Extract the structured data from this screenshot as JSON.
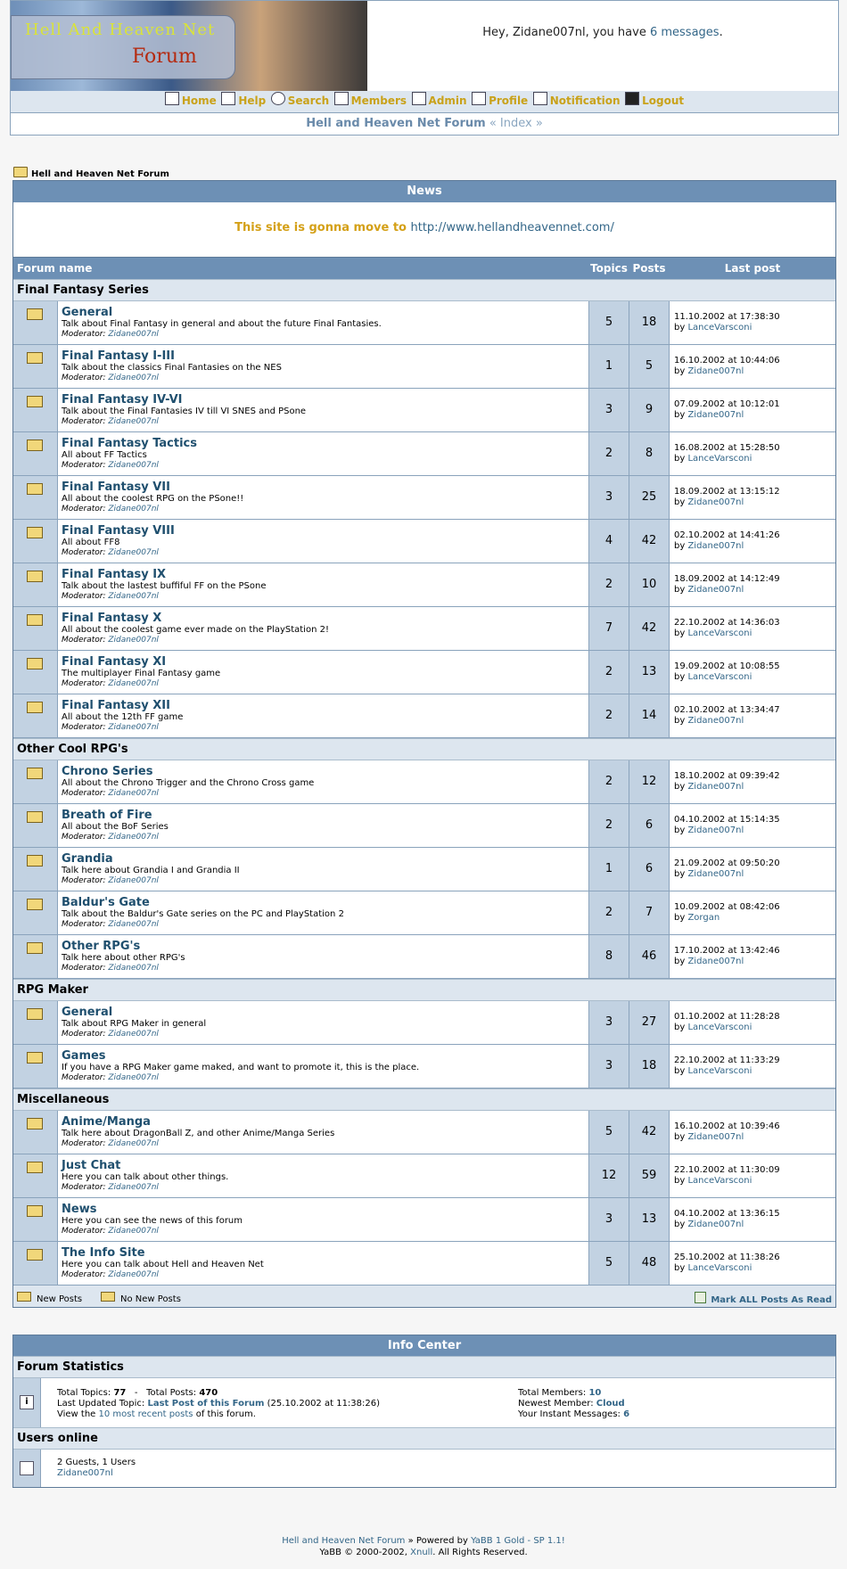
{
  "header": {
    "banner_title": "Hell And Heaven Net",
    "banner_sub": "Forum",
    "greeting_prefix": "Hey, Zidane007nl, you have ",
    "greeting_link": "6 messages",
    "greeting_suffix": "."
  },
  "nav": {
    "items": [
      {
        "label": "Home",
        "icon": "home-icon"
      },
      {
        "label": "Help",
        "icon": "help-icon"
      },
      {
        "label": "Search",
        "icon": "search-icon"
      },
      {
        "label": "Members",
        "icon": "members-icon"
      },
      {
        "label": "Admin",
        "icon": "admin-icon"
      },
      {
        "label": "Profile",
        "icon": "profile-icon"
      },
      {
        "label": "Notification",
        "icon": "notification-icon"
      },
      {
        "label": "Logout",
        "icon": "logout-icon"
      }
    ]
  },
  "crumb": {
    "forum": "Hell and Heaven Net Forum",
    "index": " « Index »"
  },
  "path": {
    "label": "Hell and Heaven Net Forum"
  },
  "news": {
    "title": "News",
    "text": "This site is gonna move to ",
    "link": "http://www.hellandheavennet.com/"
  },
  "columns": {
    "forum": "Forum name",
    "topics": "Topics",
    "posts": "Posts",
    "last": "Last post"
  },
  "categories": [
    {
      "name": "Final Fantasy Series",
      "forums": [
        {
          "name": "General",
          "desc": "Talk about Final Fantasy in general and about the future Final Fantasies.",
          "topics": "5",
          "posts": "18",
          "date": "11.10.2002 at 17:38:30",
          "by": "LanceVarsconi"
        },
        {
          "name": "Final Fantasy I-III",
          "desc": "Talk about the classics Final Fantasies on the NES",
          "topics": "1",
          "posts": "5",
          "date": "16.10.2002 at 10:44:06",
          "by": "Zidane007nl"
        },
        {
          "name": "Final Fantasy IV-VI",
          "desc": "Talk about the Final Fantasies IV till VI SNES and PSone",
          "topics": "3",
          "posts": "9",
          "date": "07.09.2002 at 10:12:01",
          "by": "Zidane007nl"
        },
        {
          "name": "Final Fantasy Tactics",
          "desc": "All about FF Tactics",
          "topics": "2",
          "posts": "8",
          "date": "16.08.2002 at 15:28:50",
          "by": "LanceVarsconi"
        },
        {
          "name": "Final Fantasy VII",
          "desc": "All about the coolest RPG on the PSone!!",
          "topics": "3",
          "posts": "25",
          "date": "18.09.2002 at 13:15:12",
          "by": "Zidane007nl"
        },
        {
          "name": "Final Fantasy VIII",
          "desc": "All about FF8",
          "topics": "4",
          "posts": "42",
          "date": "02.10.2002 at 14:41:26",
          "by": "Zidane007nl"
        },
        {
          "name": "Final Fantasy IX",
          "desc": "Talk about the lastest buffiful FF on the PSone",
          "topics": "2",
          "posts": "10",
          "date": "18.09.2002 at 14:12:49",
          "by": "Zidane007nl"
        },
        {
          "name": "Final Fantasy X",
          "desc": "All about the coolest game ever made on the PlayStation 2!",
          "topics": "7",
          "posts": "42",
          "date": "22.10.2002 at 14:36:03",
          "by": "LanceVarsconi"
        },
        {
          "name": "Final Fantasy XI",
          "desc": "The multiplayer Final Fantasy game",
          "topics": "2",
          "posts": "13",
          "date": "19.09.2002 at 10:08:55",
          "by": "LanceVarsconi"
        },
        {
          "name": "Final Fantasy XII",
          "desc": "All about the 12th FF game",
          "topics": "2",
          "posts": "14",
          "date": "02.10.2002 at 13:34:47",
          "by": "Zidane007nl"
        }
      ]
    },
    {
      "name": "Other Cool RPG's",
      "forums": [
        {
          "name": "Chrono Series",
          "desc": "All about the Chrono Trigger and the Chrono Cross game",
          "topics": "2",
          "posts": "12",
          "date": "18.10.2002 at 09:39:42",
          "by": "Zidane007nl"
        },
        {
          "name": "Breath of Fire",
          "desc": "All about the BoF Series",
          "topics": "2",
          "posts": "6",
          "date": "04.10.2002 at 15:14:35",
          "by": "Zidane007nl"
        },
        {
          "name": "Grandia",
          "desc": "Talk here about Grandia I and Grandia II",
          "topics": "1",
          "posts": "6",
          "date": "21.09.2002 at 09:50:20",
          "by": "Zidane007nl"
        },
        {
          "name": "Baldur's Gate",
          "desc": "Talk about the Baldur's Gate series on the PC and PlayStation 2",
          "topics": "2",
          "posts": "7",
          "date": "10.09.2002 at 08:42:06",
          "by": "Zorgan"
        },
        {
          "name": "Other RPG's",
          "desc": "Talk here about other RPG's",
          "topics": "8",
          "posts": "46",
          "date": "17.10.2002 at 13:42:46",
          "by": "Zidane007nl"
        }
      ]
    },
    {
      "name": "RPG Maker",
      "forums": [
        {
          "name": "General",
          "desc": "Talk about RPG Maker in general",
          "topics": "3",
          "posts": "27",
          "date": "01.10.2002 at 11:28:28",
          "by": "LanceVarsconi"
        },
        {
          "name": "Games",
          "desc": "If you have a RPG Maker game maked, and want to promote it, this is the place.",
          "topics": "3",
          "posts": "18",
          "date": "22.10.2002 at 11:33:29",
          "by": "LanceVarsconi"
        }
      ]
    },
    {
      "name": "Miscellaneous",
      "forums": [
        {
          "name": "Anime/Manga",
          "desc": "Talk here about DragonBall Z, and other Anime/Manga Series",
          "topics": "5",
          "posts": "42",
          "date": "16.10.2002 at 10:39:46",
          "by": "Zidane007nl"
        },
        {
          "name": "Just Chat",
          "desc": "Here you can talk about other things.",
          "topics": "12",
          "posts": "59",
          "date": "22.10.2002 at 11:30:09",
          "by": "LanceVarsconi"
        },
        {
          "name": "News",
          "desc": "Here you can see the news of this forum",
          "topics": "3",
          "posts": "13",
          "date": "04.10.2002 at 13:36:15",
          "by": "Zidane007nl"
        },
        {
          "name": "The Info Site",
          "desc": "Here you can talk about Hell and Heaven Net",
          "topics": "5",
          "posts": "48",
          "date": "25.10.2002 at 11:38:26",
          "by": "LanceVarsconi"
        }
      ]
    }
  ],
  "moderator": {
    "label": "Moderator:",
    "name": "Zidane007nl"
  },
  "by_label": "by ",
  "legend": {
    "new_posts": "New Posts",
    "no_new_posts": "No New Posts",
    "mark_all": "Mark ALL Posts As Read"
  },
  "info": {
    "title": "Info Center",
    "stats_title": "Forum Statistics",
    "total_topics_label": "Total Topics:",
    "total_topics": "77",
    "dash": "-",
    "total_posts_label": "Total Posts:",
    "total_posts": "470",
    "last_topic_label": "Last Updated Topic:",
    "last_topic_link": "Last Post of this Forum",
    "last_topic_date": "(25.10.2002 at 11:38:26)",
    "view_prefix": "View the ",
    "view_link": "10 most recent posts",
    "view_suffix": " of this forum.",
    "members_label": "Total Members:",
    "members": "10",
    "newest_label": "Newest Member:",
    "newest": "Cloud",
    "im_label": "Your Instant Messages:",
    "im": "6",
    "users_title": "Users online",
    "guests": "2 Guests, 1 Users",
    "online_user": "Zidane007nl"
  },
  "footer": {
    "forum": "Hell and Heaven Net Forum",
    "powered": " » Powered by ",
    "yabb": "YaBB 1 Gold - SP 1.1!",
    "copy": "YaBB © 2000-2002, ",
    "xnull": "Xnull",
    "rights": ". All Rights Reserved."
  }
}
